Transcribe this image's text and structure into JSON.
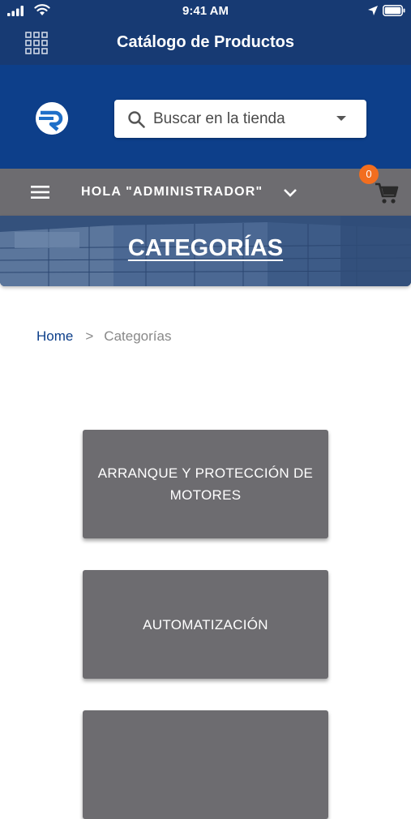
{
  "status_bar": {
    "time": "9:41 AM"
  },
  "nav": {
    "title": "Catálogo de Productos"
  },
  "search": {
    "placeholder": "Buscar en la tienda"
  },
  "user_bar": {
    "greeting": "HOLA \"ADMINISTRADOR\"",
    "cart_count": "0"
  },
  "banner": {
    "title": "CATEGORÍAS"
  },
  "breadcrumb": {
    "home": "Home",
    "separator": ">",
    "current": "Categorías"
  },
  "categories": [
    {
      "label": "ARRANQUE Y PROTECCIÓN DE MOTORES"
    },
    {
      "label": "AUTOMATIZACIÓN"
    },
    {
      "label": ""
    }
  ],
  "colors": {
    "nav": "#173a73",
    "header": "#0d3f8a",
    "gray": "#6d6c70",
    "badge": "#f26e1f"
  },
  "icons": [
    "signal-icon",
    "wifi-icon",
    "location-arrow-icon",
    "battery-icon",
    "grid-menu-icon",
    "brand-logo",
    "search-icon",
    "dropdown-caret-icon",
    "hamburger-menu-icon",
    "chevron-down-icon",
    "cart-icon"
  ]
}
